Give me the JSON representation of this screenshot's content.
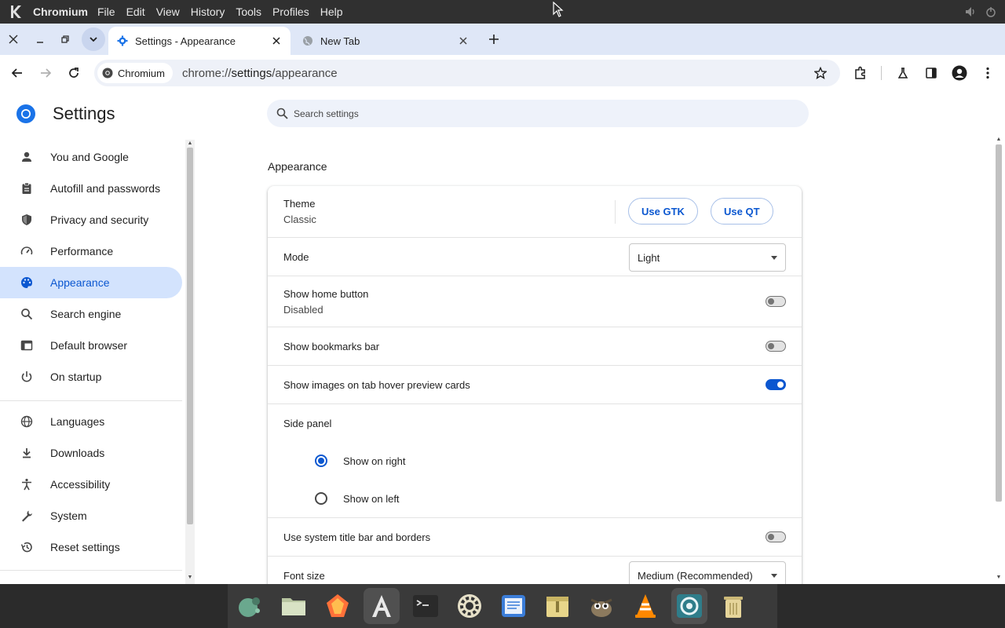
{
  "system_bar": {
    "app_name": "Chromium",
    "menus": [
      "File",
      "Edit",
      "View",
      "History",
      "Tools",
      "Profiles",
      "Help"
    ]
  },
  "tabs": [
    {
      "title": "Settings - Appearance",
      "active": true
    },
    {
      "title": "New Tab",
      "active": false
    }
  ],
  "toolbar": {
    "chip_label": "Chromium",
    "url_scheme": "chrome://",
    "url_host": "settings",
    "url_path": "/appearance"
  },
  "settings": {
    "title": "Settings",
    "search_placeholder": "Search settings",
    "nav": [
      {
        "label": "You and Google",
        "icon": "person-icon"
      },
      {
        "label": "Autofill and passwords",
        "icon": "clipboard-icon"
      },
      {
        "label": "Privacy and security",
        "icon": "shield-icon"
      },
      {
        "label": "Performance",
        "icon": "speedometer-icon"
      },
      {
        "label": "Appearance",
        "icon": "palette-icon"
      },
      {
        "label": "Search engine",
        "icon": "search-icon"
      },
      {
        "label": "Default browser",
        "icon": "browser-window-icon"
      },
      {
        "label": "On startup",
        "icon": "power-icon"
      },
      {
        "label": "Languages",
        "icon": "globe-icon"
      },
      {
        "label": "Downloads",
        "icon": "download-icon"
      },
      {
        "label": "Accessibility",
        "icon": "accessibility-icon"
      },
      {
        "label": "System",
        "icon": "wrench-icon"
      },
      {
        "label": "Reset settings",
        "icon": "history-icon"
      }
    ],
    "selected_nav": "Appearance"
  },
  "appearance": {
    "section_title": "Appearance",
    "theme": {
      "label": "Theme",
      "value": "Classic",
      "btn_gtk": "Use GTK",
      "btn_qt": "Use QT"
    },
    "mode": {
      "label": "Mode",
      "value": "Light"
    },
    "home_button": {
      "label": "Show home button",
      "sub": "Disabled",
      "enabled": false
    },
    "bookmarks_bar": {
      "label": "Show bookmarks bar",
      "enabled": false
    },
    "hover_cards": {
      "label": "Show images on tab hover preview cards",
      "enabled": true
    },
    "side_panel": {
      "label": "Side panel",
      "options": [
        "Show on right",
        "Show on left"
      ],
      "selected": "Show on right"
    },
    "title_bar": {
      "label": "Use system title bar and borders",
      "enabled": false
    },
    "font_size": {
      "label": "Font size",
      "value": "Medium (Recommended)"
    }
  },
  "dock": [
    "mint-app-icon",
    "files-icon",
    "firefox-icon",
    "text-editor-icon",
    "terminal-icon",
    "settings-gear-icon",
    "document-viewer-icon",
    "archive-icon",
    "gimp-icon",
    "vlc-icon",
    "chromium-icon",
    "trash-icon"
  ],
  "colors": {
    "accent": "#0b57d0",
    "selected_nav_bg": "#d3e3fd",
    "tabstrip_bg": "#dfe7f7"
  }
}
